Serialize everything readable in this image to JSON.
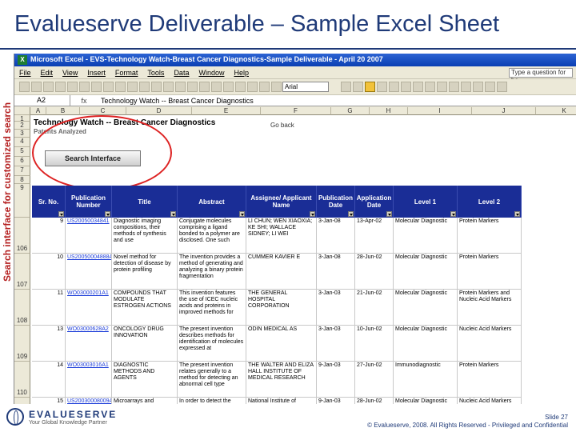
{
  "slide": {
    "title": "Evalueserve Deliverable – Sample Excel Sheet",
    "side_label": "Search interface for customized search",
    "slide_number": "Slide 27",
    "copyright": "© Evalueserve, 2008. All Rights Reserved - Privileged and Confidential",
    "logo_name": "EVALUESERVE",
    "logo_tagline": "Your Global Knowledge Partner"
  },
  "window": {
    "title": "Microsoft Excel - EVS-Technology Watch-Breast Cancer Diagnostics-Sample Deliverable - April 20 2007",
    "menu": [
      "File",
      "Edit",
      "View",
      "Insert",
      "Format",
      "Tools",
      "Data",
      "Window",
      "Help"
    ],
    "ask_placeholder": "Type a question for he",
    "font_name": "Arial",
    "name_box": "A2",
    "formula_value": "Technology Watch -- Breast Cancer Diagnostics"
  },
  "sheet": {
    "columns": [
      "A",
      "B",
      "C",
      "D",
      "E",
      "F",
      "G",
      "H",
      "I",
      "J",
      "K"
    ],
    "top_rows": [
      "1",
      "2",
      "3",
      "4",
      "5",
      "6",
      "7",
      "8",
      "9"
    ],
    "heading": "Technology Watch -- Breast Cancer Diagnostics",
    "subheading": "Patents Analyzed",
    "go_back": "Go back",
    "search_button": "Search Interface",
    "headers": [
      "Sr. No.",
      "Publication Number",
      "Title",
      "Abstract",
      "Assignee/ Applicant Name",
      "Publication Date",
      "Application Date",
      "Level 1",
      "Level 2"
    ],
    "rows": [
      {
        "rownum": "106",
        "sr": "9",
        "pub": "US20050034841",
        "title": "Diagnostic imaging compositions, their methods of synthesis and use",
        "abstract": "Conjugate molecules comprising a ligand bonded to a polymer are disclosed. One such",
        "assignee": "LI CHUN; WEN XIAOXIA; KE SHI; WALLACE SIDNEY; LI WEI",
        "pubdate": "3-Jan-08",
        "appdate": "13-Apr-02",
        "l1": "Molecular Diagnostic",
        "l2": "Protein Markers"
      },
      {
        "rownum": "107",
        "sr": "10",
        "pub": "US20050004888A1",
        "title": "Novel method for detection of disease by protein profiling",
        "abstract": "The invention provides a method of generating and analyzing a binary protein fragmentation",
        "assignee": "CUMMER KAVIER E",
        "pubdate": "3-Jan-08",
        "appdate": "28-Jun-02",
        "l1": "Molecular Diagnostic",
        "l2": "Protein Markers"
      },
      {
        "rownum": "108",
        "sr": "11",
        "pub": "WO03000201A1",
        "title": "COMPOUNDS THAT MODULATE ESTROGEN ACTIONS",
        "abstract": "This invention features the use of ICEC nucleic acids and proteins in improved methods for",
        "assignee": "THE GENERAL HOSPITAL CORPORATION",
        "pubdate": "3-Jan-03",
        "appdate": "21-Jun-02",
        "l1": "Molecular Diagnostic",
        "l2": "Protein Markers and Nucleic Acid Markers"
      },
      {
        "rownum": "109",
        "sr": "13",
        "pub": "WO03000628A2",
        "title": "ONCOLOGY DRUG INNOVATION",
        "abstract": "The present invention describes methods for identification of molecules expressed at",
        "assignee": "ODIN MEDICAL AS",
        "pubdate": "3-Jan-03",
        "appdate": "10-Jun-02",
        "l1": "Molecular Diagnostic",
        "l2": "Nucleic Acid Markers"
      },
      {
        "rownum": "110",
        "sr": "14",
        "pub": "WO03003016A1",
        "title": "DIAGNOSTIC METHODS AND AGENTS",
        "abstract": "The present invention relates generally to a method for detecting an abnormal cell type",
        "assignee": "THE WALTER AND ELIZA HALL INSTITUTE OF MEDICAL RESEARCH",
        "pubdate": "9-Jan-03",
        "appdate": "27-Jun-02",
        "l1": "Immunodiagnostic",
        "l2": "Protein Markers"
      },
      {
        "rownum": "111",
        "sr": "15",
        "pub": "US20030008009A1",
        "title": "Microarrays and methods for evaluating activity of compounds",
        "abstract": "In order to detect the effects of environmental",
        "assignee": "National Institute of Advanced Industrial Science and",
        "pubdate": "9-Jan-03",
        "appdate": "28-Jun-02",
        "l1": "Molecular Diagnostic",
        "l2": "Nucleic Acid Markers"
      }
    ]
  }
}
